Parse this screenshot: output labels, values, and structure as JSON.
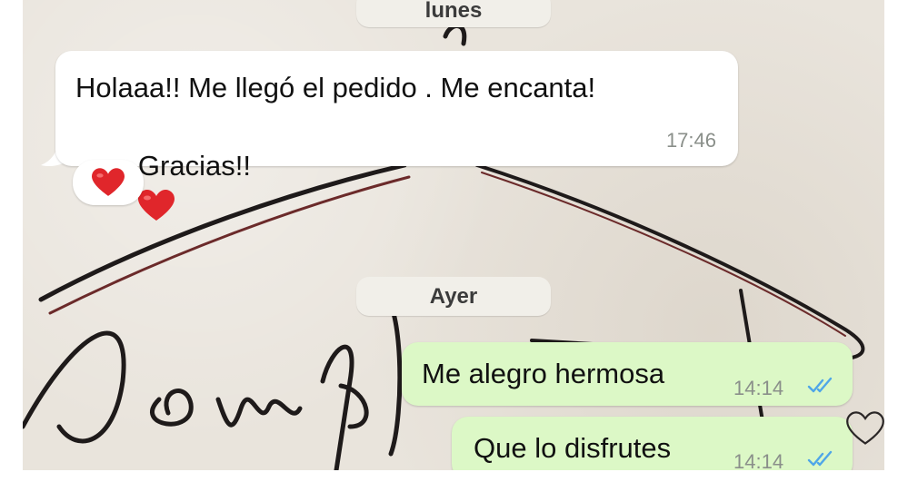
{
  "chat": {
    "dates": {
      "first": "lunes",
      "second": "Ayer"
    },
    "messages": [
      {
        "line1": "Holaaa!! Me llegó el pedido . Me encanta!",
        "line2": "Gracias!!",
        "emoji": "red-heart",
        "time": "17:46",
        "reaction": "red-heart",
        "direction": "incoming"
      },
      {
        "text": "Me alegro hermosa",
        "time": "14:14",
        "status": "read",
        "direction": "outgoing"
      },
      {
        "text": "Que lo disfrutes",
        "time": "14:14",
        "status": "read",
        "direction": "outgoing"
      }
    ],
    "colors": {
      "incoming": "#ffffff",
      "outgoing": "#dcf8c6",
      "read_ticks": "#4fa6e8",
      "heart": "#e0262b"
    }
  }
}
